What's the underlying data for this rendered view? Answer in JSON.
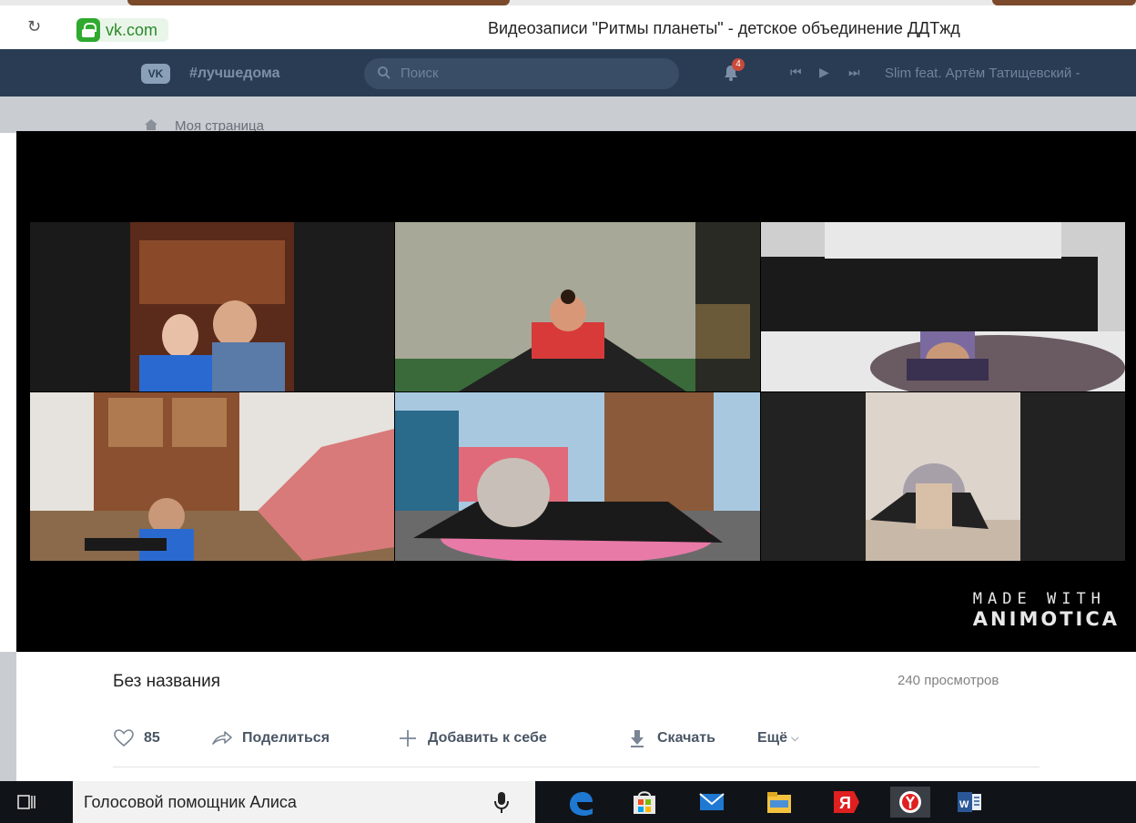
{
  "browser": {
    "url": "vk.com",
    "page_title": "Видеозаписи \"Ритмы планеты\" - детское объединение ДДТжд",
    "reload_icon": "reload-icon",
    "lock_icon": "lock-icon"
  },
  "vk_header": {
    "hashtag": "#лучшедома",
    "search_placeholder": "Поиск",
    "notification_count": "4",
    "now_playing": "Slim feat. Артём Татищевский -"
  },
  "sidebar": {
    "my_page": "Моя страница"
  },
  "video": {
    "watermark_line1": "MADE WITH",
    "watermark_line2": "ANIMOTICA"
  },
  "video_info": {
    "title": "Без названия",
    "views": "240 просмотров",
    "likes": "85",
    "share_label": "Поделиться",
    "add_label": "Добавить к себе",
    "download_label": "Скачать",
    "more_label": "Ещё"
  },
  "taskbar": {
    "assistant_label": "Голосовой помощник Алиса",
    "apps": [
      "edge",
      "store",
      "mail",
      "explorer",
      "yandex",
      "yandex-browser",
      "word"
    ]
  },
  "colors": {
    "vk_header": "#2a3c54",
    "url_green": "#2faa2f",
    "taskbar": "#101418"
  }
}
